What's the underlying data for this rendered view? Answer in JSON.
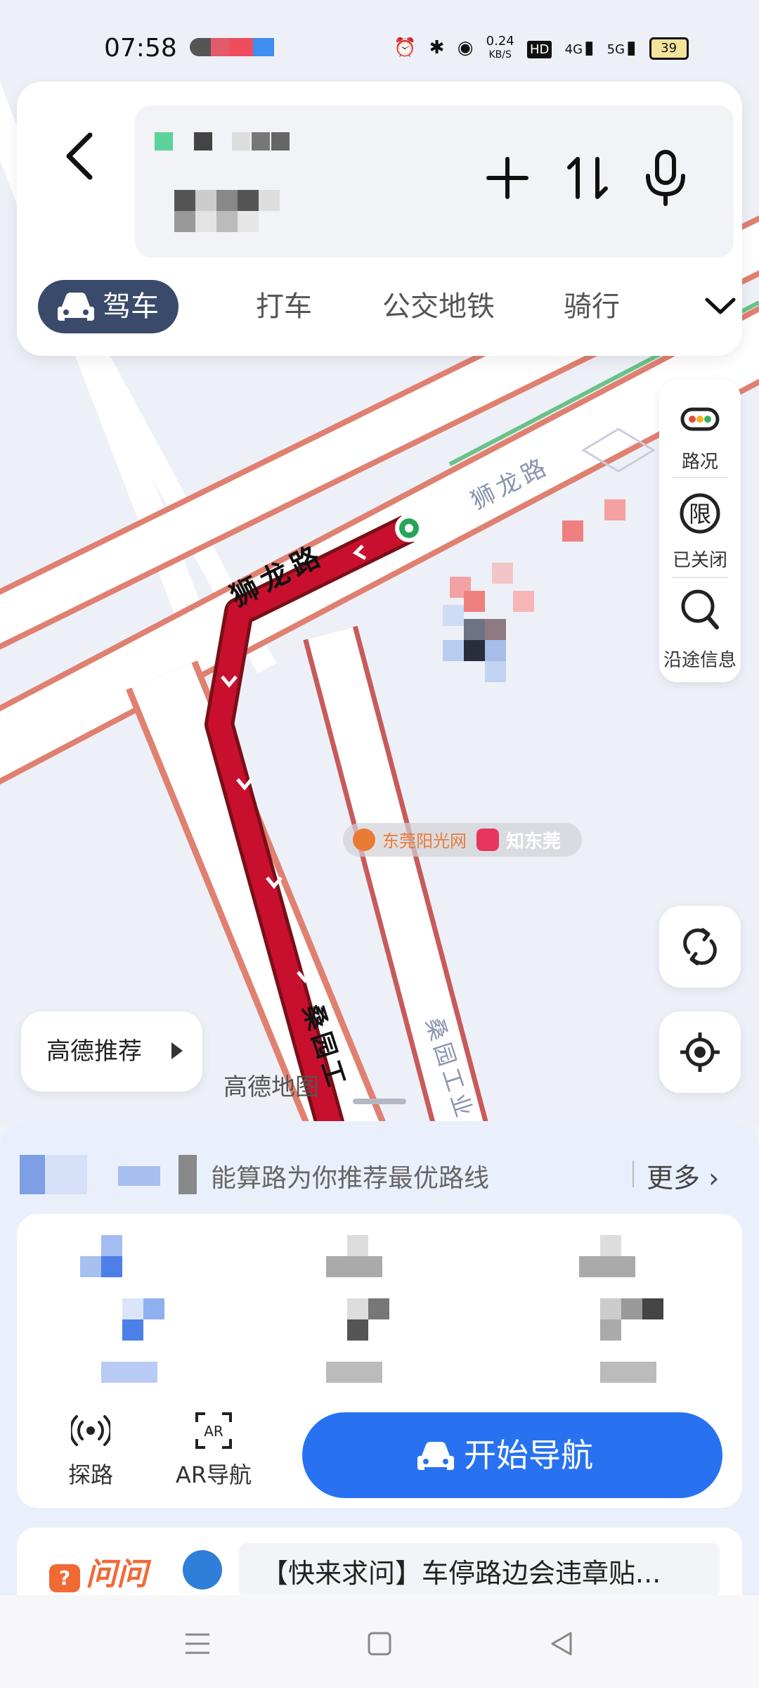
{
  "status_bar": {
    "time": "07:58",
    "net_speed_value": "0.24",
    "net_speed_unit": "KB/S",
    "hd_label": "HD",
    "network_1": "4G",
    "network_2": "5G",
    "battery": "39"
  },
  "header": {
    "back_icon": "chevron-left-icon",
    "add_icon": "plus-icon",
    "swap_icon": "swap-vertical-icon",
    "voice_icon": "microphone-icon"
  },
  "mode_tabs": [
    {
      "label": "驾车",
      "active": true
    },
    {
      "label": "打车",
      "active": false
    },
    {
      "label": "公交地铁",
      "active": false
    },
    {
      "label": "骑行",
      "active": false
    }
  ],
  "map": {
    "road_labels": [
      "狮龙路",
      "狮龙路",
      "桑园工",
      "桑园工业"
    ],
    "logo": "高德地图",
    "route_color": "#c8102e",
    "watermark_left": "东莞阳光网",
    "watermark_right": "知东莞"
  },
  "side_tools": [
    {
      "label": "路况",
      "icon": "traffic-light-icon"
    },
    {
      "label": "已关闭",
      "icon": "restriction-icon",
      "glyph": "限"
    },
    {
      "label": "沿途信息",
      "icon": "search-icon"
    }
  ],
  "recommend": {
    "label": "高德推荐"
  },
  "bottom_sheet": {
    "banner_text": "能算路为你推荐最优路线",
    "banner_more": "更多",
    "tools": [
      {
        "label": "探路",
        "icon": "radar-icon"
      },
      {
        "label": "AR导航",
        "icon": "ar-icon"
      }
    ],
    "start_button": "开始导航",
    "ask_logo": "问问",
    "ask_question": "【快来求问】车停路边会违章贴..."
  },
  "colors": {
    "accent": "#2872f2",
    "tab_active_bg": "#3a4a6a",
    "ask_orange": "#f06a36"
  }
}
